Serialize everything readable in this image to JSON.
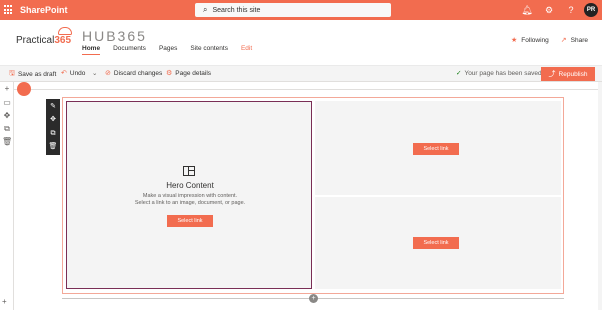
{
  "suitebar": {
    "app_name": "SharePoint",
    "search_placeholder": "Search this site",
    "avatar_initials": "PR",
    "accent": "#f26c4f"
  },
  "site": {
    "logo_text": "Practical",
    "logo_number": "365",
    "title": "HUB365",
    "nav": [
      "Home",
      "Documents",
      "Pages",
      "Site contents",
      "Edit"
    ],
    "actions": {
      "following": "Following",
      "share": "Share"
    }
  },
  "commandbar": {
    "save_draft": "Save as draft",
    "undo": "Undo",
    "discard": "Discard changes",
    "page_details": "Page details",
    "status": "Your page has been saved",
    "republish": "Republish"
  },
  "hero": {
    "title": "Hero Content",
    "desc_line1": "Make a visual impression with content.",
    "desc_line2": "Select a link to an image, document, or page.",
    "select_link": "Select link"
  },
  "tiles": {
    "tile1_select": "Select link",
    "tile2_select": "Select link"
  }
}
